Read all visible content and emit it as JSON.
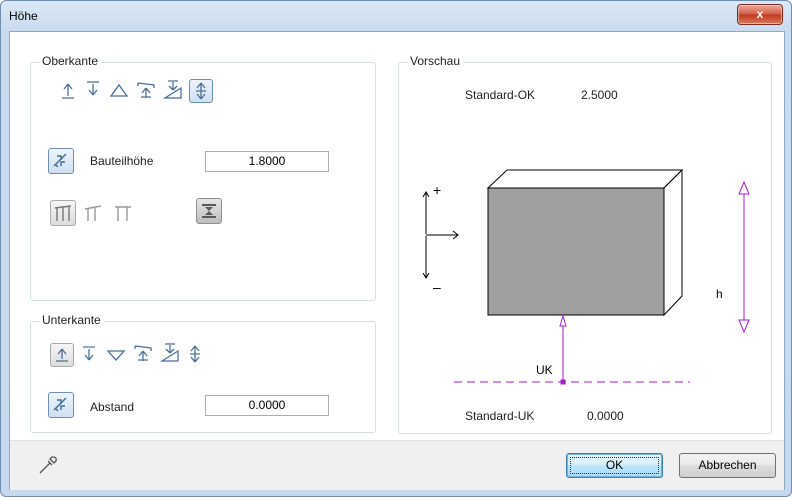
{
  "window": {
    "title": "Höhe",
    "close_glyph": "x"
  },
  "oberkante": {
    "label": "Oberkante",
    "icons": [
      "arrow-up-line-icon",
      "arrow-down-line-icon",
      "triangle-outline-icon",
      "slope-arrow-icon",
      "ramp-arrow-icon",
      "double-arrow-icon"
    ],
    "selected": "double-arrow-icon",
    "bauteilhoehe_label": "Bauteilhöhe",
    "bauteilhoehe_value": "1.8000",
    "style_icons": [
      "wall-top-full-icon",
      "wall-top-left-icon",
      "wall-top-right-icon",
      "hourglass-icon"
    ]
  },
  "unterkante": {
    "label": "Unterkante",
    "icons": [
      "arrow-up-line-icon",
      "arrow-down-line-icon",
      "triangle-down-outline-icon",
      "slope-arrow-icon",
      "ramp-arrow-icon",
      "double-arrow-icon"
    ],
    "selected": "arrow-up-line-icon",
    "abstand_label": "Abstand",
    "abstand_value": "0.0000"
  },
  "vorschau": {
    "label": "Vorschau",
    "ok_label": "Standard-OK",
    "ok_value": "2.5000",
    "uk_label": "Standard-UK",
    "uk_value": "0.0000",
    "diagram_uk": "UK",
    "diagram_h": "h",
    "diagram_plus": "+",
    "diagram_minus": "–",
    "colors": {
      "block": "#a0a0a0",
      "accent": "#a020c8"
    }
  },
  "footer": {
    "picker_icon": "eyedropper-icon",
    "ok_button": "OK",
    "cancel_button": "Abbrechen"
  }
}
